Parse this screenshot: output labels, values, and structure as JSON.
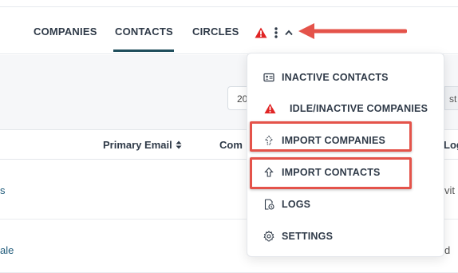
{
  "nav": {
    "tabs": [
      {
        "label": "COMPANIES",
        "active": false
      },
      {
        "label": "CONTACTS",
        "active": true
      },
      {
        "label": "CIRCLES",
        "active": false
      }
    ],
    "icons": [
      "warning-icon",
      "kebab-menu-icon",
      "chevron-up-icon"
    ]
  },
  "toolbar": {
    "date_value": "20",
    "right_button_partial": "st"
  },
  "table": {
    "headers": [
      "Primary Email",
      "Com",
      "Log"
    ],
    "rows": [
      {
        "first_cell": "s",
        "last_cell": "vit"
      },
      {
        "first_cell": "ale",
        "last_cell": "d"
      }
    ]
  },
  "dropdown": {
    "items": [
      {
        "label": "INACTIVE CONTACTS",
        "icon": "contact-card-icon"
      },
      {
        "label": "IDLE/INACTIVE COMPANIES",
        "icon": "warning-icon"
      },
      {
        "label": "IMPORT COMPANIES",
        "icon": "upload-icon",
        "highlighted": true
      },
      {
        "label": "IMPORT CONTACTS",
        "icon": "upload-icon",
        "highlighted": true
      },
      {
        "label": "LOGS",
        "icon": "log-file-icon"
      },
      {
        "label": "SETTINGS",
        "icon": "gear-icon"
      }
    ]
  },
  "colors": {
    "active_tab_underline": "#1f4e5c",
    "warning": "#e02424",
    "annotation": "#e4534a"
  }
}
